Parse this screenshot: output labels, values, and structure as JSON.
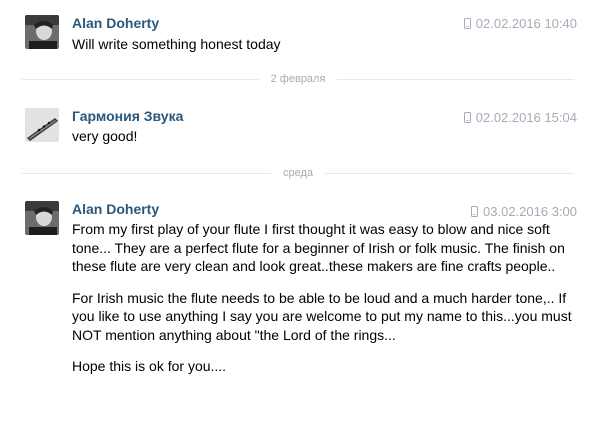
{
  "messages": [
    {
      "author": "Alan Doherty",
      "timestamp": "02.02.2016 10:40",
      "device_icon": "phone-icon",
      "paragraphs": [
        "Will write something honest today"
      ]
    },
    {
      "author": "Гармония Звука",
      "timestamp": "02.02.2016 15:04",
      "device_icon": "phone-icon",
      "paragraphs": [
        "very good!"
      ]
    },
    {
      "author": "Alan Doherty",
      "timestamp": "03.02.2016 3:00",
      "device_icon": "phone-icon",
      "paragraphs": [
        "From my first play of your flute I first thought it was easy to blow and nice soft tone... They are a perfect flute for a beginner of Irish or folk music. The finish on these flute are very clean and look great..these makers are fine crafts people..",
        "For Irish music the flute needs to be able to be loud and a much harder tone,.. If you like to use anything I say you are welcome to put my name to this...you must NOT mention anything about \"the Lord of the rings...",
        "Hope this is ok for you...."
      ]
    }
  ],
  "dividers": [
    "2 февраля",
    "среда"
  ],
  "colors": {
    "author": "#2b587a",
    "meta": "#a3adb7",
    "divider_line": "#e5e8ec"
  }
}
